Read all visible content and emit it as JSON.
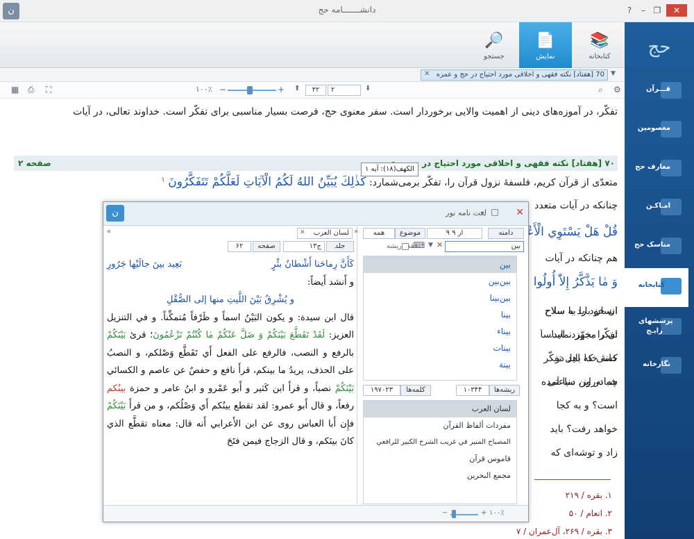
{
  "window": {
    "title": "دانشـــــــامه حج"
  },
  "toolbar": {
    "tabs": [
      {
        "label": "کتابخانه"
      },
      {
        "label": "نمایش"
      },
      {
        "label": "جستجو"
      }
    ]
  },
  "address": {
    "value": "70 [هفتاد] نکته فقهی و اخلاقی مورد احتیاج در حج و عمره"
  },
  "controls": {
    "zoom": "۱۰۰٪",
    "page_total": "۳۲",
    "page_current": "۲"
  },
  "content": {
    "para1": "تفکّر، در آموزه‌های دینی از اهمیت والایی برخوردار است. سفر معنوی حج، فرصت بسیار مناسبی برای تفکّر است. خداوند تعالی، در آیات",
    "section_title": "۷۰ [هفتاد] نکته فقهی و اخلاقی مورد احتیاج در حج و عمره",
    "page_label": "صفحه ۲",
    "para2_a": "متعدّی از قرآن کریم، فلسفهٔ نزول قرآن را، تفکّر برمی‌شمارد:",
    "verse1": "كَذٰلِكَ يُبَيِّنُ اللهُ لَكُمُ الْآيَاتِ لَعَلَّكُمْ تَتَفَكَّرُونَ",
    "verse1_mark": "١",
    "para3": "چنانکه در آیات متعدد",
    "verse2": "قُلْ هَلْ يَسْتَوِي الْأَعْمىٰ",
    "para4": "هم چنانکه در آیات",
    "verse3": "وَ مٰا يَذَّكَّرُ إِلاّٰ أُولُوا",
    "para5_a": "انسان باید با سلاح",
    "para5_b": "ان خود را به سلاح",
    "para6_a": "تفکّر مجهّز نماید.",
    "para6_b": "ان را بخورد. اساساً",
    "para7_a": "کسی که اهل تفکّر",
    "para7_b": "خانهٔ خدا باید در",
    "para8_a": "شبانه‌روز، ساعتی",
    "para8_b": "چه در این دنیا آمده",
    "para9_a": "است؟ و به کجا",
    "para10_a": "خواهد رفت؟ باید",
    "para11_a": "زاد و توشه‌ای که",
    "refs": [
      "١. بقره / ۲۱۹",
      "٢. انعام / ۵۰",
      "٣. بقره / ۲۶۹، آل‌عمران / ۷"
    ]
  },
  "tooltip": {
    "text": "الکهف(۱۸): آیه ۱"
  },
  "sidebar": {
    "items": [
      {
        "label": "قـــرآن"
      },
      {
        "label": "معصومین"
      },
      {
        "label": "معارف حج"
      },
      {
        "label": "امـاکـن"
      },
      {
        "label": "مناسک حج"
      },
      {
        "label": "کتابخانه"
      },
      {
        "label": "پرسشهای رایـج"
      },
      {
        "label": "نگارخانه"
      }
    ]
  },
  "dialog": {
    "title": "لغت نامه نور",
    "source": "لسان العرب",
    "vol_label": "جلد",
    "vol_value": "ج۱۳",
    "page_label": "صفحه",
    "page_value": "۶۲",
    "domain_label": "دامنه",
    "count_value": "۹ از ۹",
    "topic_label": "موضوع",
    "topic_value": "همه",
    "search_value": "بین",
    "root_only": "فقط ریشه",
    "roots_label": "ریشه‌ها",
    "roots_value": "۱۰۳۴۴",
    "words_label": "کلمه‌ها",
    "words_value": "۱۹۷۰۲۳",
    "zoom": "۱۰۰٪",
    "words": [
      "بين",
      "بين‌بين",
      "بين‌بينا",
      "بينا",
      "بيناء",
      "بينات",
      "بينة"
    ],
    "books": [
      "لسان العرب",
      "مفردات ألفاظ القرآن",
      "المصباح المنير في غريب الشرح الكبير للرافعي",
      "قاموس قرآن",
      "مجمع البحرين"
    ],
    "text": {
      "poem1_a": "كَأَنَّ رِماحَنا أَشْطانُ بئْرٍ",
      "poem1_b": "بَعِيد بينَ جالَيْها جَرُورِ",
      "l2": "و أَنشد أَيضاً:",
      "poem2": "و يُشْرِقُ بَيْنَ اللَّيتِ منها إلى الصُّقْلِ",
      "p1": "قال ابن سيدة: و يكون البَيْنُ اسماً و ظَرْفاً مُتمكِّناً. و في التنزيل العزيز:",
      "q1": "لَقَدْ تَقَطَّعَ بَيْنَكُمْ وَ ضَلَّ عَنْكُمْ مٰا كُنْتُمْ تَزْعُمُونَ",
      "p2": "؛ قرئ",
      "q2": "بَيْنَكُمْ",
      "p3": "بالرفع و النصب، فالرفع على الفعل أَي تَقَطَّع وَصْلكم، و النصبُ على الحذف، يريدُ ما بينكم، قرأَ نافع و حفصٌ عن عاصم و الكسائي",
      "q3": "بَيْنَكُمْ",
      "p4": "نصباً، و قرأَ ابن كَثير و أَبو عَمْرو و ابنُ عامر و حمزة",
      "q4": "بينُكم",
      "p5": "رفعاً، و قال أَبو عمرو: لقد تقطع بينُكم أَي وَصْلُكم، و من قرأَ",
      "q5": "بَيْنَكُمْ",
      "p6": "فإِن أَبا العباس روى عن ابن الأَعرابي أَنه قال: معناه تقطَّع الذي كانَ بينَكم، و قال الزجاج فيمن فتَحَ"
    }
  }
}
